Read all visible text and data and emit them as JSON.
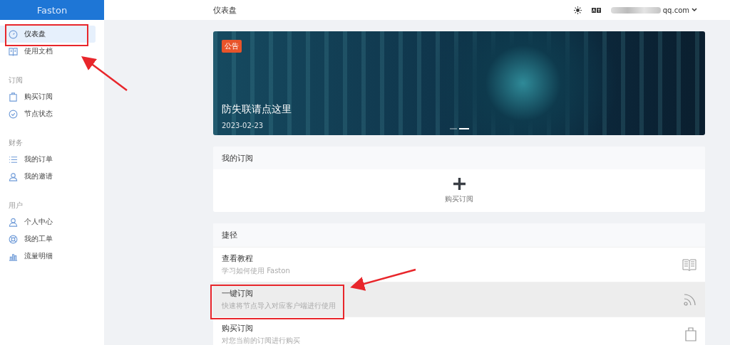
{
  "sidebar": {
    "brand": "Faston",
    "groups": [
      {
        "items": [
          {
            "label": "仪表盘",
            "selected": true
          },
          {
            "label": "使用文档",
            "selected": false
          }
        ]
      },
      {
        "title": "订阅",
        "items": [
          {
            "label": "购买订阅",
            "selected": false
          },
          {
            "label": "节点状态",
            "selected": false
          }
        ]
      },
      {
        "title": "财务",
        "items": [
          {
            "label": "我的订单",
            "selected": false
          },
          {
            "label": "我的邀请",
            "selected": false
          }
        ]
      },
      {
        "title": "用户",
        "items": [
          {
            "label": "个人中心",
            "selected": false
          },
          {
            "label": "我的工单",
            "selected": false
          },
          {
            "label": "流量明细",
            "selected": false
          }
        ]
      }
    ]
  },
  "topbar": {
    "title": "仪表盘",
    "account": "qq.com"
  },
  "banner": {
    "badge": "公告",
    "title": "防失联请点这里",
    "date": "2023-02-23",
    "slides": [
      {
        "selected": false
      },
      {
        "selected": true
      }
    ]
  },
  "subscriptions": {
    "title": "我的订阅",
    "action": "购买订阅"
  },
  "shortcuts": {
    "title": "捷径",
    "items": [
      {
        "title": "查看教程",
        "description": "学习如何使用 Faston",
        "highlighted": false
      },
      {
        "title": "一键订阅",
        "description": "快速将节点导入对应客户端进行使用",
        "highlighted": true
      },
      {
        "title": "购买订阅",
        "description": "对您当前的订阅进行购买",
        "highlighted": false
      }
    ]
  }
}
